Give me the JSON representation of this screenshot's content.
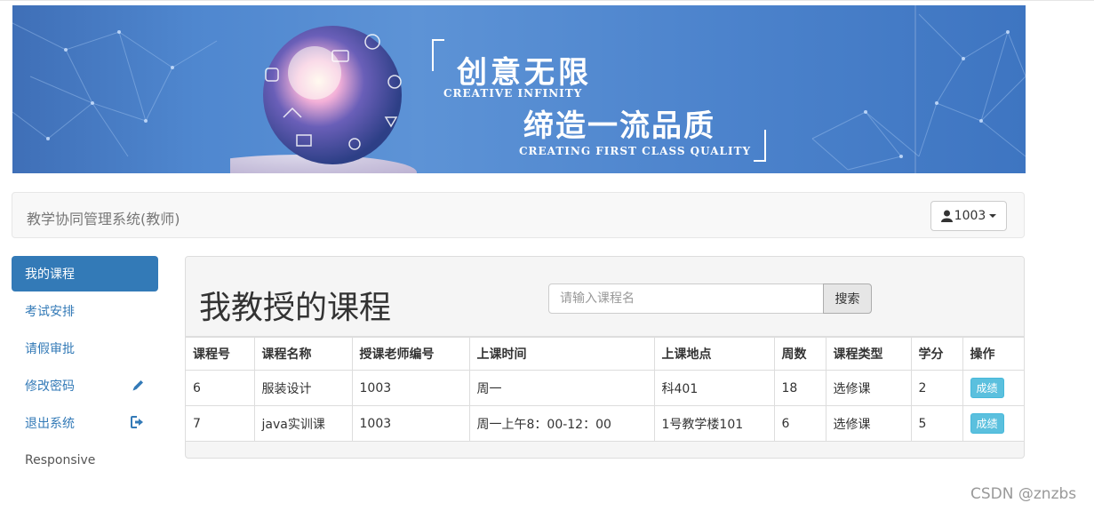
{
  "banner": {
    "slogan_main": "创意无限",
    "slogan_main_en": "CREATIVE INFINITY",
    "slogan_sub": "缔造一流品质",
    "slogan_sub_en": "CREATING FIRST CLASS QUALITY"
  },
  "navbar": {
    "brand": "教学协同管理系统(教师)",
    "user_label": "1003",
    "user_icon": "user-icon"
  },
  "sidebar": {
    "items": [
      {
        "label": "我的课程",
        "active": true
      },
      {
        "label": "考试安排"
      },
      {
        "label": "请假审批"
      },
      {
        "label": "修改密码",
        "icon": "pencil-icon"
      },
      {
        "label": "退出系统",
        "icon": "logout-icon"
      },
      {
        "label": "Responsive"
      }
    ]
  },
  "main": {
    "title": "我教授的课程",
    "search_placeholder": "请输入课程名",
    "search_button": "搜索",
    "columns": [
      "课程号",
      "课程名称",
      "授课老师编号",
      "上课时间",
      "上课地点",
      "周数",
      "课程类型",
      "学分",
      "操作"
    ],
    "rows": [
      {
        "id": "6",
        "name": "服装设计",
        "teacher": "1003",
        "time": "周一",
        "place": "科401",
        "weeks": "18",
        "type": "选修课",
        "credit": "2",
        "action": "成绩"
      },
      {
        "id": "7",
        "name": "java实训课",
        "teacher": "1003",
        "time": "周一上午8：00-12：00",
        "place": "1号教学楼101",
        "weeks": "6",
        "type": "选修课",
        "credit": "5",
        "action": "成绩"
      }
    ]
  },
  "watermark": "CSDN @znzbs",
  "colors": {
    "primary": "#337ab7",
    "info": "#5bc0de"
  }
}
